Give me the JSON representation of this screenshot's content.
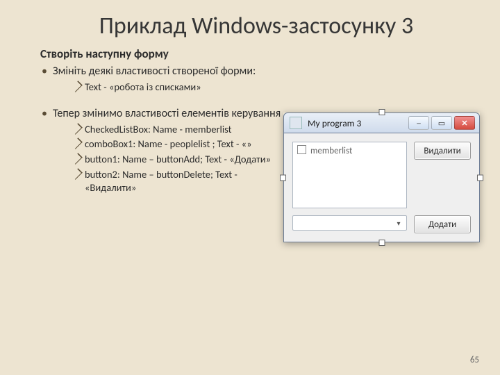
{
  "title": "Приклад Windows-застосунку 3",
  "subhead": "Створіть наступну форму",
  "bullet1": "Змініть деякі властивості створеної форми:",
  "sub1_1": "Text - «робота із списками»",
  "bullet2": "Тепер змінимо властивості елементів керування",
  "sub2_1": "CheckedListBox: Name - memberlist",
  "sub2_2": "comboBox1: Name - peoplelist ; Text - «»",
  "sub2_3": "button1: Name – buttonAdd; Text - «Додати»",
  "sub2_4": "button2: Name – buttonDelete; Text - «Видалити»",
  "page_number": "65",
  "form": {
    "title": "My program 3",
    "memberlist_placeholder": "memberlist",
    "btn_delete": "Видалити",
    "btn_add": "Додати",
    "combo_value": ""
  }
}
